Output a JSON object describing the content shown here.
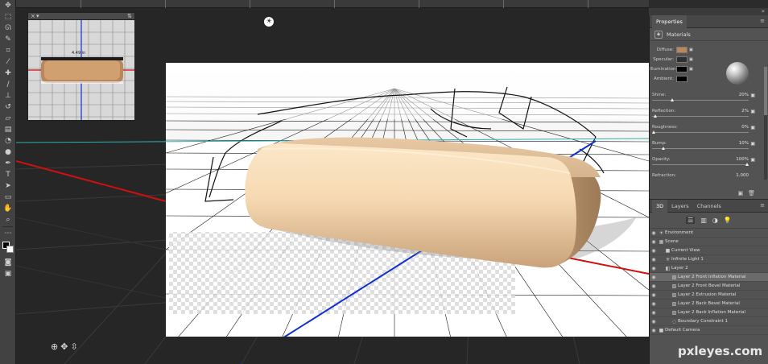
{
  "panel": {
    "properties_tab": "Properties",
    "materials_label": "Materials",
    "materials": [
      {
        "label": "Diffuse:",
        "color": "#b9875a"
      },
      {
        "label": "Specular:",
        "color": "#2f2f2f"
      },
      {
        "label": "Illumination:",
        "color": "#000000"
      },
      {
        "label": "Ambient:",
        "color": "#000000"
      }
    ],
    "sliders": [
      {
        "label": "Shine:",
        "value": "20%",
        "fraction": 0.2
      },
      {
        "label": "Reflection:",
        "value": "2%",
        "fraction": 0.02
      },
      {
        "label": "Roughness:",
        "value": "0%",
        "fraction": 0.0
      },
      {
        "label": "Bump:",
        "value": "10%",
        "fraction": 0.1
      },
      {
        "label": "Opacity:",
        "value": "100%",
        "fraction": 1.0
      },
      {
        "label": "Refraction:",
        "value": "1.000",
        "fraction": null
      }
    ],
    "layer_tabs": [
      "3D",
      "Layers",
      "Channels"
    ],
    "layers": [
      {
        "label": "Environment",
        "icon": "environment-icon",
        "indent": 0,
        "selected": false
      },
      {
        "label": "Scene",
        "icon": "scene-icon",
        "indent": 0,
        "selected": false
      },
      {
        "label": "Current View",
        "icon": "camera-icon",
        "indent": 1,
        "selected": false
      },
      {
        "label": "Infinite Light 1",
        "icon": "light-icon",
        "indent": 1,
        "selected": false
      },
      {
        "label": "Layer 2",
        "icon": "mesh-icon",
        "indent": 1,
        "selected": false
      },
      {
        "label": "Layer 2 Front Inflation Material",
        "icon": "material-icon",
        "indent": 2,
        "selected": true
      },
      {
        "label": "Layer 2 Front Bevel Material",
        "icon": "material-icon",
        "indent": 2,
        "selected": false
      },
      {
        "label": "Layer 2 Extrusion Material",
        "icon": "material-icon",
        "indent": 2,
        "selected": false
      },
      {
        "label": "Layer 2 Back Bevel Material",
        "icon": "material-icon",
        "indent": 2,
        "selected": false
      },
      {
        "label": "Layer 2 Back Inflation Material",
        "icon": "material-icon",
        "indent": 2,
        "selected": false
      },
      {
        "label": "Boundary Constraint 1",
        "icon": "constraint-icon",
        "indent": 2,
        "selected": false
      },
      {
        "label": "Default Camera",
        "icon": "camera-icon",
        "indent": 0,
        "selected": false
      }
    ]
  },
  "preview": {
    "dimension_label": "4.49 in"
  },
  "colors": {
    "object_light": "#f7ddb8",
    "object_dark": "#b08a64",
    "axis_x": "#d01010",
    "axis_z": "#1030d0",
    "axis_y": "#30b0b0"
  },
  "watermark": "pxleyes.com"
}
